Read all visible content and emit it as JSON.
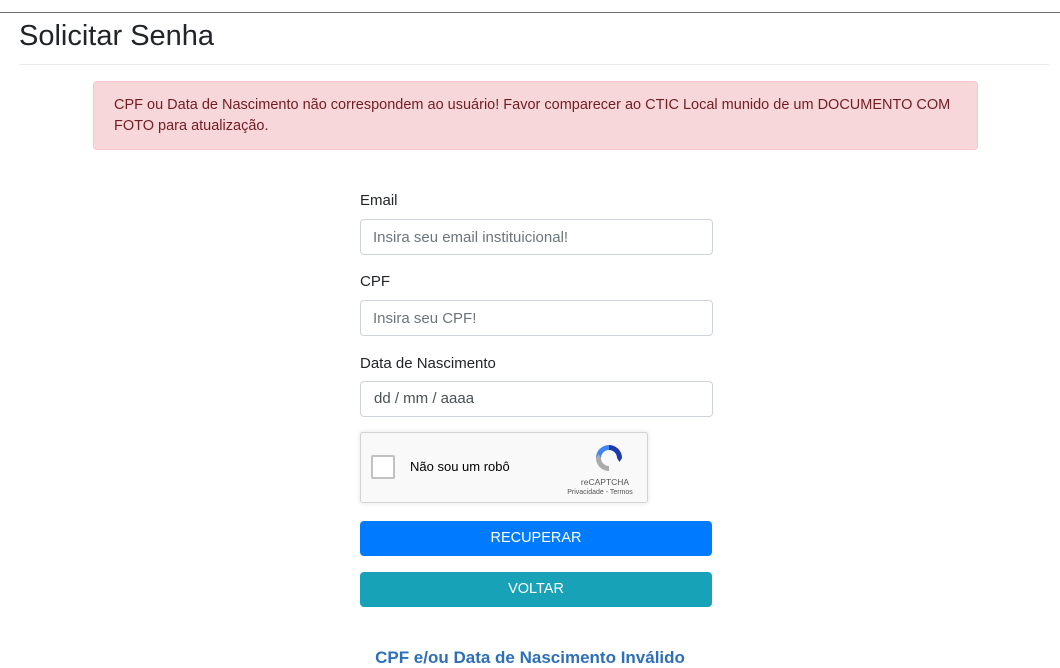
{
  "page": {
    "title": "Solicitar Senha"
  },
  "alert": {
    "message": "CPF ou Data de Nascimento não correspondem ao usuário! Favor comparecer ao CTIC Local munido de um DOCUMENTO COM FOTO para atualização."
  },
  "form": {
    "email": {
      "label": "Email",
      "placeholder": "Insira seu email instituicional!",
      "value": ""
    },
    "cpf": {
      "label": "CPF",
      "placeholder": "Insira seu CPF!",
      "value": ""
    },
    "birthdate": {
      "label": "Data de Nascimento",
      "placeholder": "dd / mm / aaaa"
    }
  },
  "captcha": {
    "label": "Não sou um robô",
    "brand": "reCAPTCHA",
    "links": "Privacidade - Termos",
    "icon": "recaptcha-icon"
  },
  "buttons": {
    "recover": "RECUPERAR",
    "back": "VOLTAR"
  },
  "footer": {
    "message": "CPF e/ou Data de Nascimento Inválido"
  },
  "colors": {
    "primary": "#007bff",
    "info": "#17a2b8",
    "alert_bg": "#f8d7da",
    "alert_text": "#721c24",
    "footer_text": "#2e6fb7"
  }
}
